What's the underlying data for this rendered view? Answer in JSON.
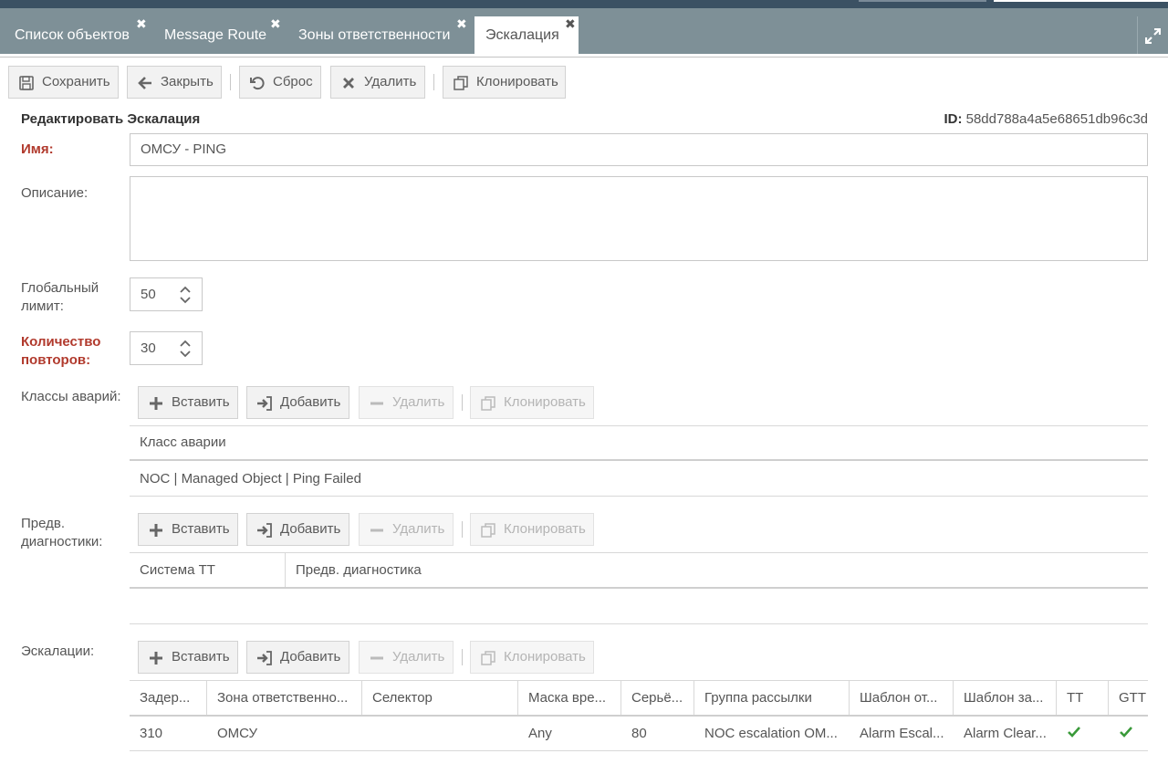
{
  "tabs": [
    {
      "label": "Список объектов"
    },
    {
      "label": "Message Route"
    },
    {
      "label": "Зоны ответственности"
    },
    {
      "label": "Эскалация"
    }
  ],
  "tab_close_glyph": "✖",
  "toolbar": {
    "save": "Сохранить",
    "close": "Закрыть",
    "reset": "Сброс",
    "delete": "Удалить",
    "clone": "Клонировать"
  },
  "form": {
    "heading": "Редактировать Эскалация",
    "id_label": "ID:",
    "id_value": "58dd788a4a5e68651db96c3d",
    "name_label": "Имя:",
    "name_value": "ОМСУ - PING",
    "description_label": "Описание:",
    "description_value": "",
    "global_limit_label_1": "Глобальный",
    "global_limit_label_2": "лимит:",
    "global_limit_value": "50",
    "repeat_label_1": "Количество",
    "repeat_label_2": "повторов:",
    "repeat_value": "30"
  },
  "grid_toolbar": {
    "insert": "Вставить",
    "add": "Добавить",
    "delete": "Удалить",
    "clone": "Клонировать"
  },
  "alarm_classes": {
    "label": "Классы аварий:",
    "header": "Класс аварии",
    "rows": [
      "NOC | Managed Object | Ping Failed"
    ]
  },
  "prediag": {
    "label_1": "Предв.",
    "label_2": "диагностики:",
    "headers": [
      "Система ТТ",
      "Предв. диагностика"
    ]
  },
  "escalations": {
    "label": "Эскалации:",
    "headers": [
      "Задер...",
      "Зона ответственно...",
      "Селектор",
      "Маска вре...",
      "Серьё...",
      "Группа рассылки",
      "Шаблон от...",
      "Шаблон за...",
      "TT",
      "GTT"
    ],
    "rows": [
      {
        "delay": "310",
        "zone": "ОМСУ",
        "selector": "",
        "mask": "Any",
        "severity": "80",
        "group": "NOC escalation OM...",
        "tpl_open": "Alarm Escal...",
        "tpl_close": "Alarm Clear...",
        "tt": true,
        "gtt": true
      }
    ]
  },
  "colors": {
    "header_bar": "#3b5163",
    "tab_bar": "#7e9097",
    "required": "#b13a2d",
    "check": "#3a9a3a"
  }
}
